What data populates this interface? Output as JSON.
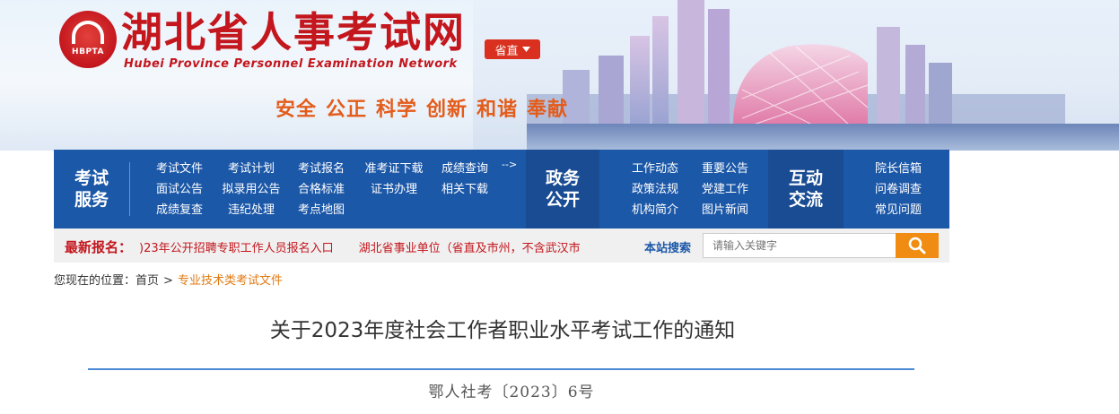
{
  "header": {
    "logo_abbr": "HBPTA",
    "site_title": "湖北省人事考试网",
    "site_subtitle": "Hubei Province Personnel Examination Network",
    "region_button": "省直",
    "slogan": [
      "安全",
      "公正",
      "科学",
      "创新",
      "和谐",
      "奉献"
    ]
  },
  "nav": {
    "exam_services": {
      "label_line1": "考试",
      "label_line2": "服务",
      "rows": [
        [
          "考试文件",
          "考试计划",
          "考试报名",
          "准考证下载",
          "成绩查询"
        ],
        [
          "面试公告",
          "拟录用公告",
          "合格标准",
          "证书办理",
          "相关下载"
        ],
        [
          "成绩复查",
          "违纪处理",
          "考点地图"
        ]
      ],
      "more": "-->"
    },
    "public_affairs": {
      "label_line1": "政务",
      "label_line2": "公开",
      "rows": [
        [
          "工作动态",
          "重要公告"
        ],
        [
          "政策法规",
          "党建工作"
        ],
        [
          "机构简介",
          "图片新闻"
        ]
      ]
    },
    "interaction": {
      "label_line1": "互动",
      "label_line2": "交流",
      "rows": [
        [
          "院长信箱"
        ],
        [
          "问卷调查"
        ],
        [
          "常见问题"
        ]
      ]
    }
  },
  "ticker": {
    "label": "最新报名：",
    "items": [
      ")23年公开招聘专职工作人员报名入口",
      "湖北省事业单位（省直及市州，不含武汉市"
    ]
  },
  "search": {
    "label": "本站搜索",
    "placeholder": "请输入关键字"
  },
  "breadcrumb": {
    "prefix": "您现在的位置：",
    "home": "首页",
    "separator": ">",
    "current": "专业技术类考试文件"
  },
  "article": {
    "title": "关于2023年度社会工作者职业水平考试工作的通知",
    "doc_number": "鄂人社考〔2023〕6号"
  },
  "colors": {
    "brand_red": "#c3161d",
    "nav_blue": "#1c58a8",
    "slogan_orange": "#e35c1b",
    "search_orange": "#f08c12",
    "breadcrumb_current": "#e07a12"
  }
}
